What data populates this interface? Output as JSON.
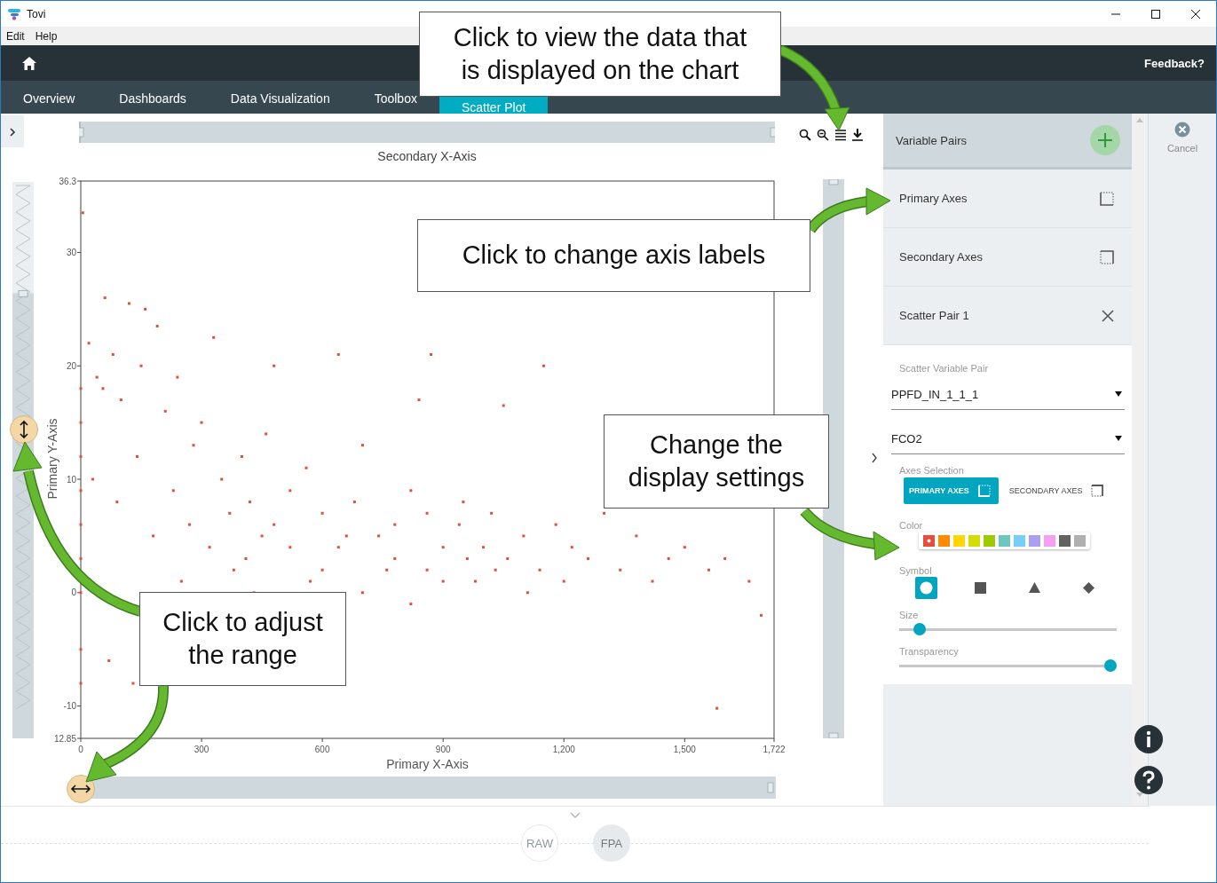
{
  "window": {
    "title": "Tovi"
  },
  "menu": [
    "Edit",
    "Help"
  ],
  "header": {
    "feedback": "Feedback?"
  },
  "tabs": [
    {
      "label": "Overview",
      "selected": false
    },
    {
      "label": "Dashboards",
      "selected": false
    },
    {
      "label": "Data Visualization",
      "selected": false
    },
    {
      "label": "Toolbox",
      "selected": false
    },
    {
      "label": "Scatter Plot",
      "selected": true
    }
  ],
  "chart": {
    "secondary_x_axis_label": "Secondary X-Axis",
    "range_sliders": [
      {
        "level": 1
      },
      {
        "level": 0.8
      },
      {
        "level": 1
      },
      {
        "level": 1
      }
    ],
    "chart_data": {
      "type": "scatter",
      "xlabel": "Primary X-Axis",
      "ylabel": "Primary Y-Axis",
      "xlim": [
        0,
        1722
      ],
      "ylim": [
        -12.85,
        36.3
      ],
      "xticks": [
        0,
        300,
        600,
        900,
        {
          "value": 1200,
          "label": "1,200"
        },
        {
          "value": 1500,
          "label": "1,500"
        },
        {
          "value": 1722,
          "label": "1,722"
        }
      ],
      "yticks": [
        {
          "value": -12.85,
          "label": "12.85"
        },
        -10,
        0,
        10,
        20,
        30,
        36.3
      ],
      "x": [
        0,
        0,
        0,
        0,
        0,
        0,
        0,
        0,
        0,
        5,
        60,
        120,
        160,
        190,
        330,
        20,
        40,
        55,
        80,
        100,
        150,
        210,
        240,
        280,
        300,
        350,
        400,
        420,
        460,
        480,
        520,
        560,
        600,
        640,
        680,
        700,
        740,
        780,
        820,
        860,
        900,
        940,
        980,
        1020,
        1060,
        1100,
        1140,
        1180,
        1220,
        1260,
        1300,
        1340,
        1380,
        1420,
        1460,
        1500,
        1560,
        1600,
        1660,
        1690,
        1580,
        130,
        70,
        250,
        380,
        430,
        570,
        700,
        760,
        820,
        900,
        960,
        1030,
        1110,
        30,
        90,
        140,
        180,
        230,
        270,
        320,
        370,
        410,
        450,
        520,
        600,
        660,
        780,
        860,
        950,
        1000,
        1200,
        840,
        1050,
        640,
        1150,
        480,
        870
      ],
      "series": [
        {
          "color": "#e0503c",
          "values": [
            -5,
            0,
            3,
            6,
            9,
            12,
            15,
            18,
            -8,
            33.5,
            26,
            25.5,
            25,
            23.5,
            22.5,
            22,
            19,
            18,
            21,
            17,
            20,
            16,
            19,
            13,
            15,
            10,
            12,
            8,
            14,
            6,
            9,
            11,
            7,
            4,
            8,
            13,
            5,
            3,
            9,
            2,
            4,
            6,
            1,
            7,
            3,
            5,
            2,
            6,
            4,
            3,
            7,
            2,
            5,
            1,
            3,
            4,
            2,
            3,
            1,
            -2,
            -10.2,
            -8,
            -6,
            1,
            2,
            0,
            1,
            0,
            2,
            -1,
            1,
            3,
            2,
            0,
            10,
            8,
            12,
            5,
            9,
            6,
            4,
            7,
            3,
            5,
            4,
            2,
            5,
            6,
            7,
            8,
            4,
            1,
            17,
            16.5,
            21,
            20,
            20,
            21
          ]
        }
      ]
    }
  },
  "variable_pairs": {
    "title": "Variable Pairs",
    "items": [
      {
        "label": "Primary Axes",
        "kind": "primary"
      },
      {
        "label": "Secondary Axes",
        "kind": "secondary"
      },
      {
        "label": "Scatter Pair 1",
        "kind": "pair"
      }
    ]
  },
  "settings": {
    "section_label": "Scatter Variable Pair",
    "fields": [
      {
        "value": "PPFD_IN_1_1_1"
      },
      {
        "value": "FCO2"
      }
    ],
    "axes_label": "Axes Selection",
    "axes_options": [
      {
        "label": "PRIMARY AXES",
        "kind": "primary",
        "selected": true
      },
      {
        "label": "SECONDARY AXES",
        "kind": "secondary",
        "selected": false
      }
    ],
    "color_label": "Color",
    "colors": [
      {
        "color": "#e74c3c",
        "selected": true
      },
      {
        "color": "#ff8c00",
        "selected": false
      },
      {
        "color": "#ffd600",
        "selected": false
      },
      {
        "color": "#d4dd00",
        "selected": false
      },
      {
        "color": "#9ccc00",
        "selected": false
      },
      {
        "color": "#6cc7c0",
        "selected": false
      },
      {
        "color": "#74d0f7",
        "selected": false
      },
      {
        "color": "#aaa0f0",
        "selected": false
      },
      {
        "color": "#f5a0f0",
        "selected": false
      },
      {
        "color": "#616161",
        "selected": false
      },
      {
        "color": "#b0b0b0",
        "selected": false
      }
    ],
    "symbol_label": "Symbol",
    "symbols": [
      {
        "kind": "circle",
        "selected": true
      },
      {
        "kind": "square",
        "selected": false
      },
      {
        "kind": "triangle",
        "selected": false
      },
      {
        "kind": "diamond",
        "selected": false
      }
    ],
    "sliders": [
      {
        "label": "Size",
        "level": 0.07
      },
      {
        "label": "Transparency",
        "level": 1
      }
    ]
  },
  "cancel": {
    "label": "Cancel"
  },
  "views": [
    {
      "label": "RAW",
      "selected": false
    },
    {
      "label": "FPA",
      "selected": true
    }
  ],
  "callouts": [
    {
      "text": "Click to view the data that is displayed on the chart"
    },
    {
      "text": "Click to change axis labels"
    },
    {
      "text": "Change the display settings"
    },
    {
      "text": "Click to adjust the range"
    }
  ]
}
